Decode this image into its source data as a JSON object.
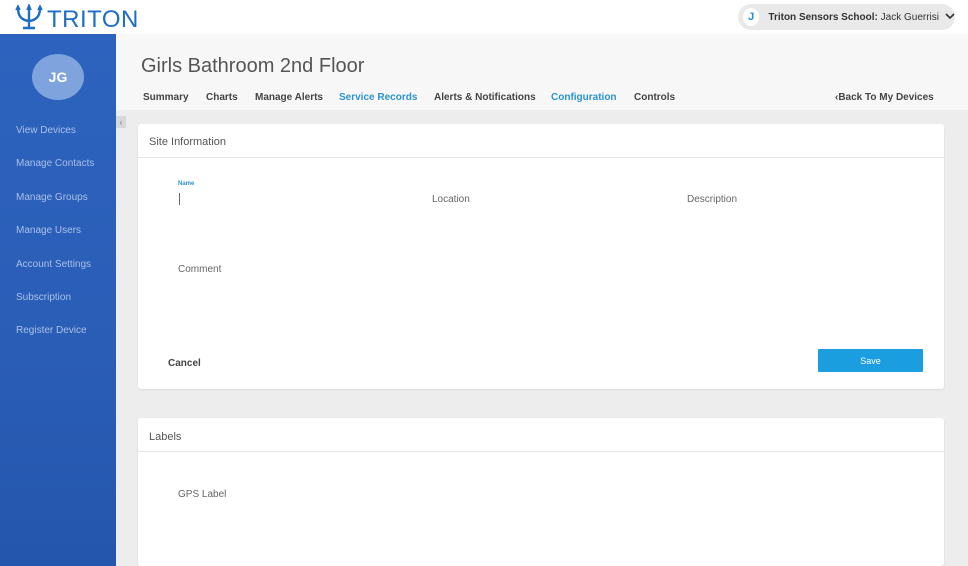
{
  "brand": {
    "name": "TRITON"
  },
  "user": {
    "initial": "J",
    "org": "Triton Sensors School:",
    "name": "Jack Guerrisi"
  },
  "sidebar": {
    "avatar_initials": "JG",
    "items": [
      {
        "label": "View Devices"
      },
      {
        "label": "Manage Contacts"
      },
      {
        "label": "Manage Groups"
      },
      {
        "label": "Manage Users"
      },
      {
        "label": "Account Settings"
      },
      {
        "label": "Subscription"
      },
      {
        "label": "Register Device"
      }
    ]
  },
  "page": {
    "title": "Girls Bathroom 2nd Floor",
    "back_label": "‹Back To My Devices"
  },
  "tabs": [
    {
      "label": "Summary"
    },
    {
      "label": "Charts"
    },
    {
      "label": "Manage Alerts"
    },
    {
      "label": "Service Records"
    },
    {
      "label": "Alerts & Notifications"
    },
    {
      "label": "Configuration"
    },
    {
      "label": "Controls"
    }
  ],
  "site_info": {
    "title": "Site Information",
    "name_label": "Name",
    "location_label": "Location",
    "description_label": "Description",
    "comment_label": "Comment",
    "cancel_label": "Cancel",
    "save_label": "Save"
  },
  "labels_card": {
    "title": "Labels",
    "gps_label": "GPS Label"
  },
  "colors": {
    "accent": "#2a93cf",
    "sidebar": "#2d63be",
    "brand": "#1d6ec4",
    "save": "#1a9ee0"
  }
}
